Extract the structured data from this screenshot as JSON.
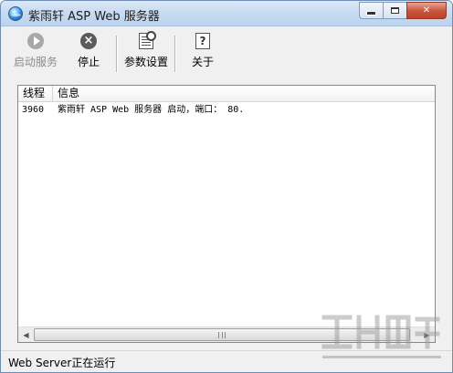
{
  "window": {
    "title": "紫雨轩 ASP Web 服务器",
    "icon": "app-globe-icon"
  },
  "caption": {
    "minimize": "minimize",
    "maximize": "maximize",
    "close": "✕"
  },
  "toolbar": {
    "buttons": [
      {
        "label": "启动服务",
        "icon": "play-icon",
        "enabled": false
      },
      {
        "label": "停止",
        "icon": "stop-icon",
        "enabled": true
      },
      {
        "label": "参数设置",
        "icon": "settings-icon",
        "enabled": true
      },
      {
        "label": "关于",
        "icon": "about-icon",
        "enabled": true
      }
    ]
  },
  "log": {
    "columns": [
      "线程",
      "信息"
    ],
    "rows": [
      {
        "thread": "3960",
        "info": "紫雨轩 ASP Web 服务器 启动，端口： 80."
      }
    ]
  },
  "status": {
    "text": "Web Server正在运行"
  },
  "colors": {
    "titlebar": "#c9dcf1",
    "window_bg": "#f0f0f0",
    "close_button": "#c7523a"
  }
}
